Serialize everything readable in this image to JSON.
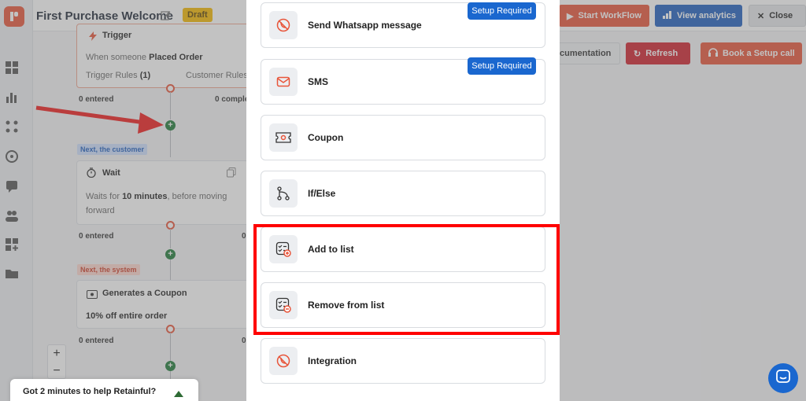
{
  "header": {
    "title": "First Purchase Welcome",
    "draft_badge": "Draft",
    "start_workflow": "Start WorkFlow",
    "view_analytics": "View analytics",
    "close": "Close",
    "documentation": "cumentation",
    "refresh": "Refresh",
    "book_setup_call": "Book a Setup call"
  },
  "workflow": {
    "trigger": {
      "title": "Trigger",
      "when_label": "When someone",
      "when_value": "Placed Order",
      "rules_label": "Trigger Rules",
      "rules_count": "(1)",
      "customer_rules": "Customer Rules",
      "entered": "0 entered",
      "completed": "0 comple"
    },
    "wait_tag": "Next, the customer",
    "wait": {
      "title": "Wait",
      "text_prefix": "Waits for",
      "text_bold": "10 minutes",
      "text_suffix": ", before moving",
      "text_line2": "forward",
      "entered": "0 entered",
      "other": "0"
    },
    "coupon_tag": "Next, the system",
    "coupon": {
      "title": "Generates a Coupon",
      "value": "10% off entire order",
      "entered": "0 entered",
      "other": "0"
    }
  },
  "zoom": {
    "in": "+",
    "out": "−"
  },
  "feedback": {
    "text": "Got 2 minutes to help Retainful?"
  },
  "modal": {
    "options": [
      {
        "label": "Send Whatsapp message",
        "icon": "whatsapp-disabled-icon",
        "badge": "Setup Required"
      },
      {
        "label": "SMS",
        "icon": "sms-icon",
        "badge": "Setup Required"
      },
      {
        "label": "Coupon",
        "icon": "coupon-icon",
        "badge": ""
      },
      {
        "label": "If/Else",
        "icon": "branch-icon",
        "badge": ""
      },
      {
        "label": "Add to list",
        "icon": "add-to-list-icon",
        "badge": ""
      },
      {
        "label": "Remove from list",
        "icon": "remove-from-list-icon",
        "badge": ""
      },
      {
        "label": "Integration",
        "icon": "integration-icon",
        "badge": ""
      }
    ]
  },
  "colors": {
    "brand": "#e8553a",
    "primary_blue": "#1a67cf",
    "danger": "#d0222e",
    "highlight": "#ff0000",
    "success": "#1e7b37"
  }
}
